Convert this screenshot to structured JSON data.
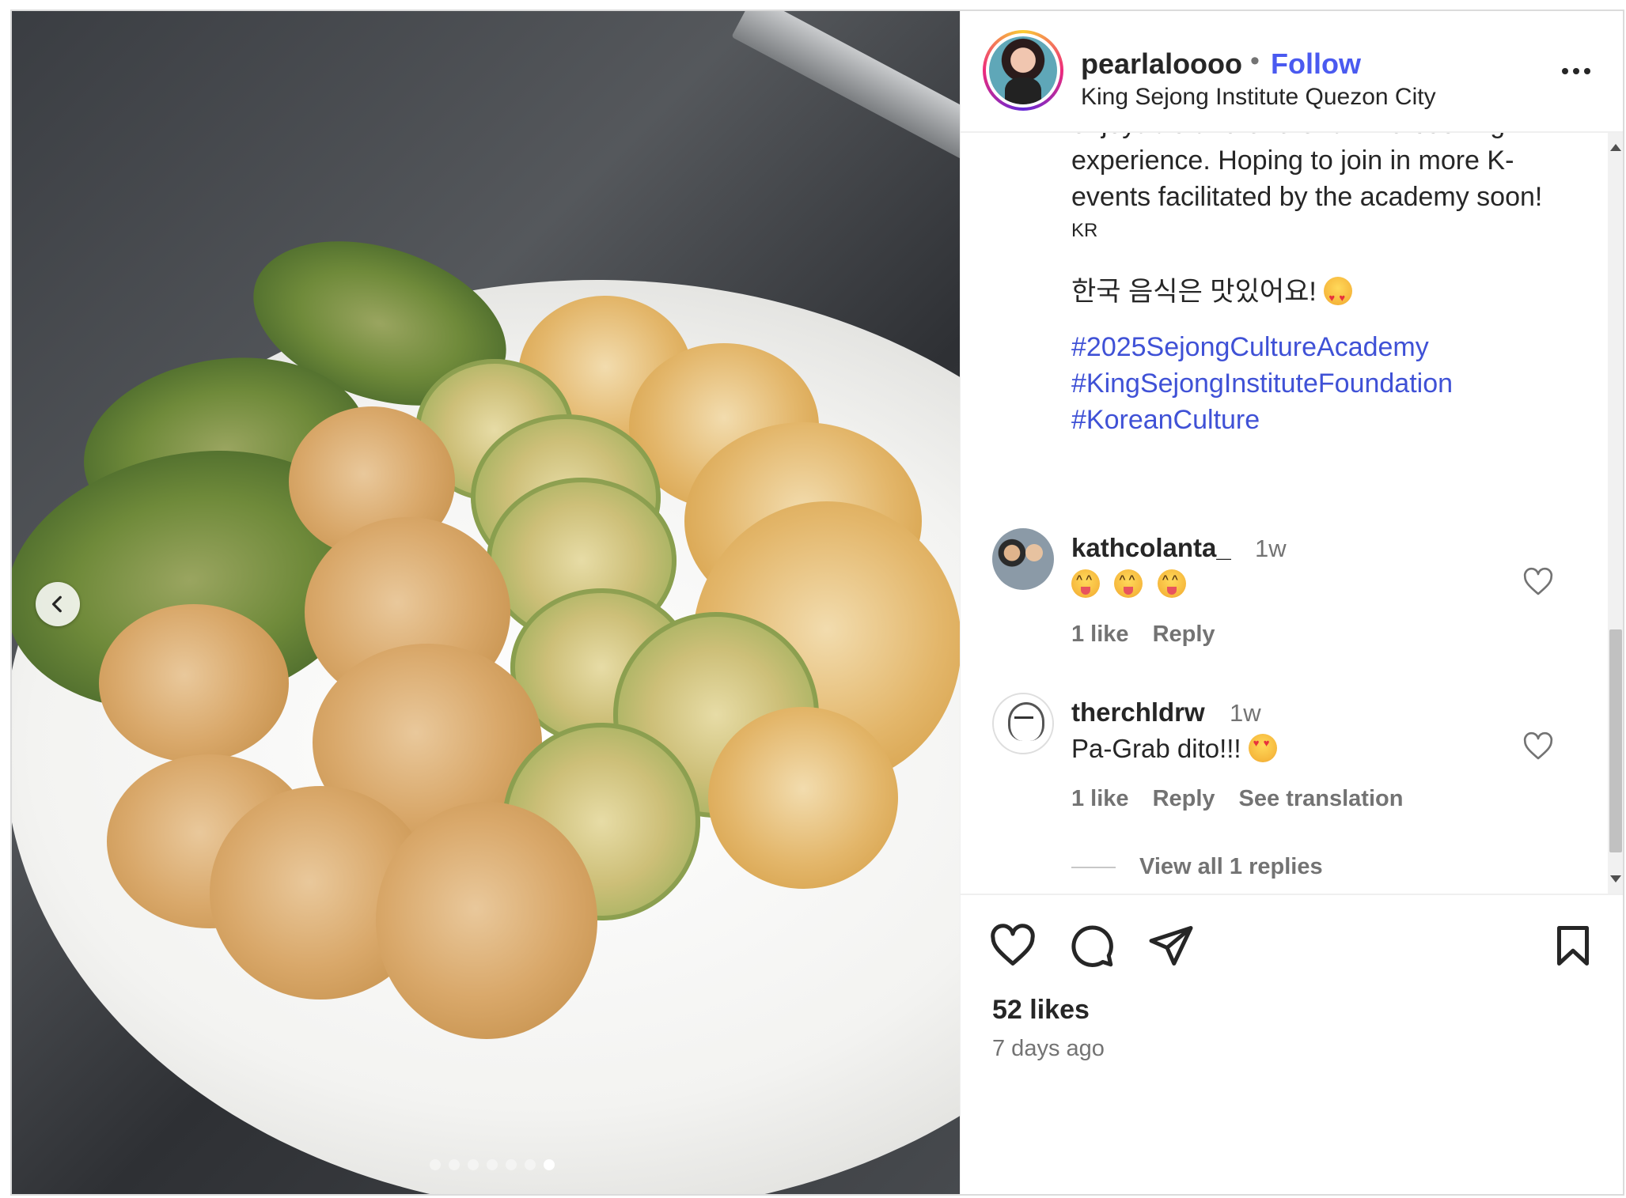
{
  "post": {
    "username": "pearlaloooo",
    "separator": "•",
    "follow_label": "Follow",
    "location": "King Sejong Institute Quezon City",
    "more_icon": "more-options-icon"
  },
  "caption": {
    "line1": "enjoyable and one-of-a-kind cooking",
    "line2": "experience. Hoping to join in more K-",
    "line3": "events facilitated by the academy soon!",
    "lang_tag": "KR",
    "korean_line": "한국 음식은 맛있어요!",
    "hashtags": [
      "#2025SejongCultureAcademy",
      "#KingSejongInstituteFoundation",
      "#KoreanCulture"
    ]
  },
  "comments": [
    {
      "username": "kathcolanta_",
      "time": "1w",
      "text": "",
      "likes": "1 like",
      "reply": "Reply",
      "emoji_count": 3
    },
    {
      "username": "therchldrw",
      "time": "1w",
      "text": "Pa-Grab dito!!!",
      "likes": "1 like",
      "reply": "Reply",
      "translate": "See translation"
    }
  ],
  "view_replies": "View all 1 replies",
  "footer": {
    "likes": "52 likes",
    "date": "7 days ago"
  },
  "carousel": {
    "total": 7,
    "active": 7
  },
  "colors": {
    "link_blue": "#4a5af0",
    "hashtag_blue": "#3f51d6",
    "secondary_text": "#737373"
  }
}
